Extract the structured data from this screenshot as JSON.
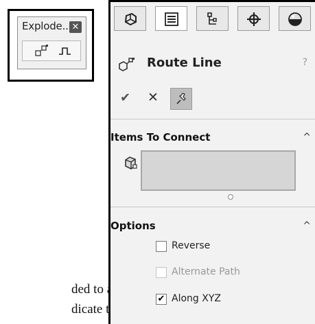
{
  "explode_toolbar": {
    "title": "Explode...",
    "close_glyph": "✕",
    "tools": [
      {
        "icon": "explode-step-icon"
      },
      {
        "icon": "route-line-icon"
      }
    ]
  },
  "property_manager": {
    "tabs": [
      {
        "icon": "feature-manager-icon",
        "active": false
      },
      {
        "icon": "property-manager-icon",
        "active": true
      },
      {
        "icon": "configuration-manager-icon",
        "active": false
      },
      {
        "icon": "dimxpert-manager-icon",
        "active": false
      },
      {
        "icon": "display-manager-icon",
        "active": false
      }
    ],
    "title": "Route Line",
    "help_glyph": "?",
    "actions": {
      "ok_glyph": "✔",
      "cancel_glyph": "✕"
    },
    "sections": [
      {
        "title": "Items To Connect",
        "caret": "^"
      },
      {
        "title": "Options",
        "caret": "^",
        "checkboxes": [
          {
            "label": "Reverse",
            "checked": false,
            "enabled": true
          },
          {
            "label": "Alternate Path",
            "checked": false,
            "enabled": false
          },
          {
            "label": "Along XYZ",
            "checked": true,
            "enabled": true
          }
        ]
      }
    ]
  },
  "document_text": {
    "line1": "ded to an",
    "line2": "dicate the"
  }
}
